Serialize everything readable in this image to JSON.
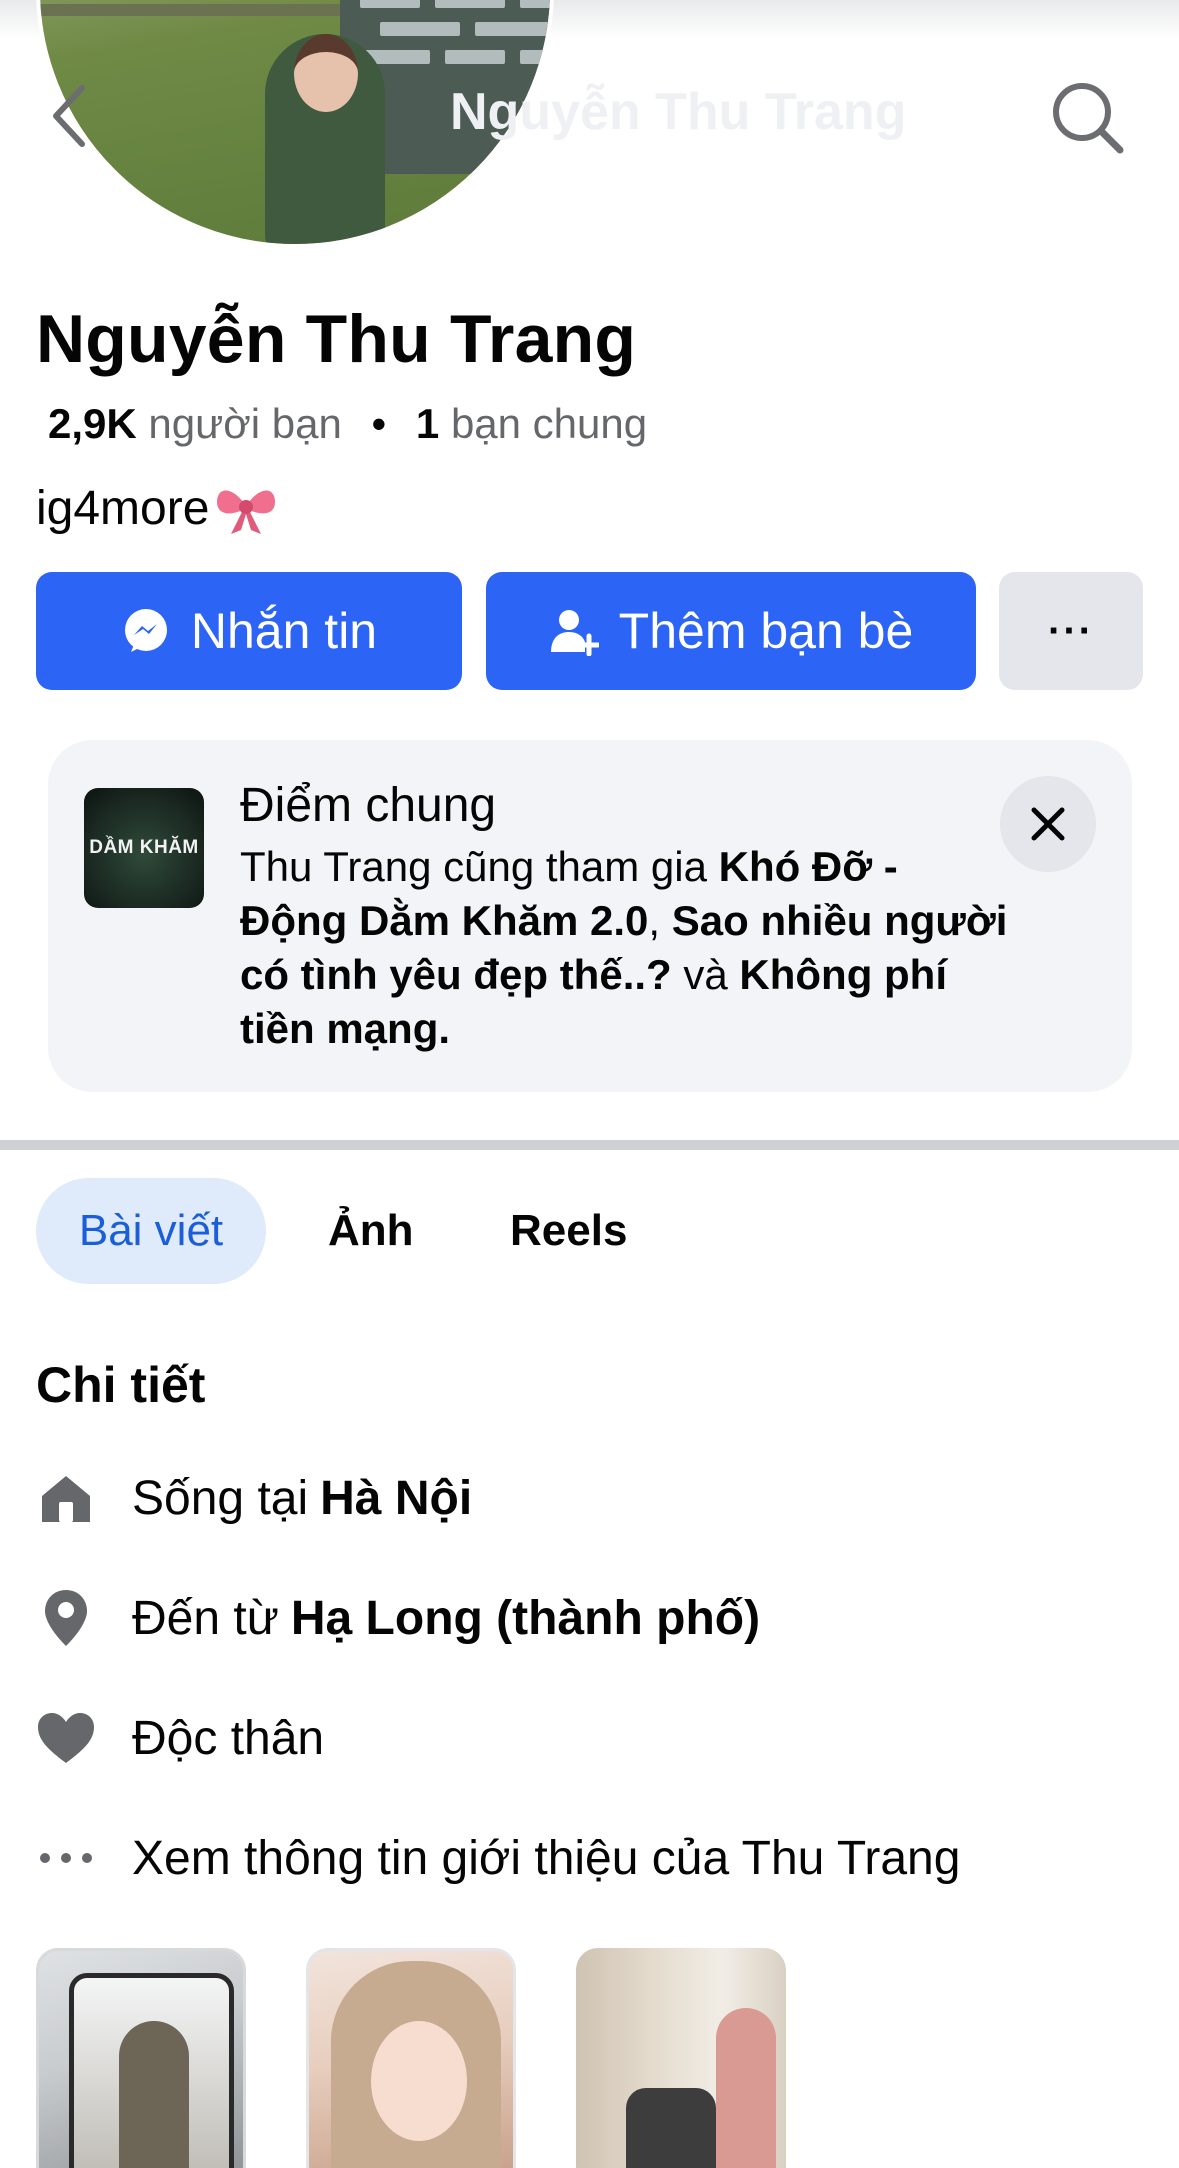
{
  "header": {
    "ghost_title": "Nguyễn Thu Trang"
  },
  "profile": {
    "name": "Nguyễn Thu Trang",
    "friends_count": "2,9K",
    "friends_label": "người bạn",
    "mutual_count": "1",
    "mutual_label": "bạn chung",
    "bio": "ig4more"
  },
  "actions": {
    "message_label": "Nhắn tin",
    "add_friend_label": "Thêm bạn bè",
    "more_label": "···"
  },
  "common_card": {
    "thumb_text": "DẦM KHĂM",
    "title": "Điểm chung",
    "prefix": "Thu Trang cũng tham gia",
    "group1": "Khó Đỡ - Động Dằm Khăm 2.0",
    "group2": "Sao nhiều người có tình yêu đẹp thế..?",
    "conj": "và",
    "group3": "Không phí tiền mạng."
  },
  "tabs": [
    {
      "label": "Bài viết"
    },
    {
      "label": "Ảnh"
    },
    {
      "label": "Reels"
    }
  ],
  "details": {
    "title": "Chi tiết",
    "lives_prefix": "Sống tại",
    "lives_value": "Hà Nội",
    "from_prefix": "Đến từ",
    "from_value": "Hạ Long (thành phố)",
    "relationship": "Độc thân",
    "see_about": "Xem thông tin giới thiệu của Thu Trang"
  },
  "colors": {
    "primary_blue": "#2c64f6",
    "tab_active_bg": "#dfeafb",
    "tab_active_text": "#1b5fd8"
  }
}
